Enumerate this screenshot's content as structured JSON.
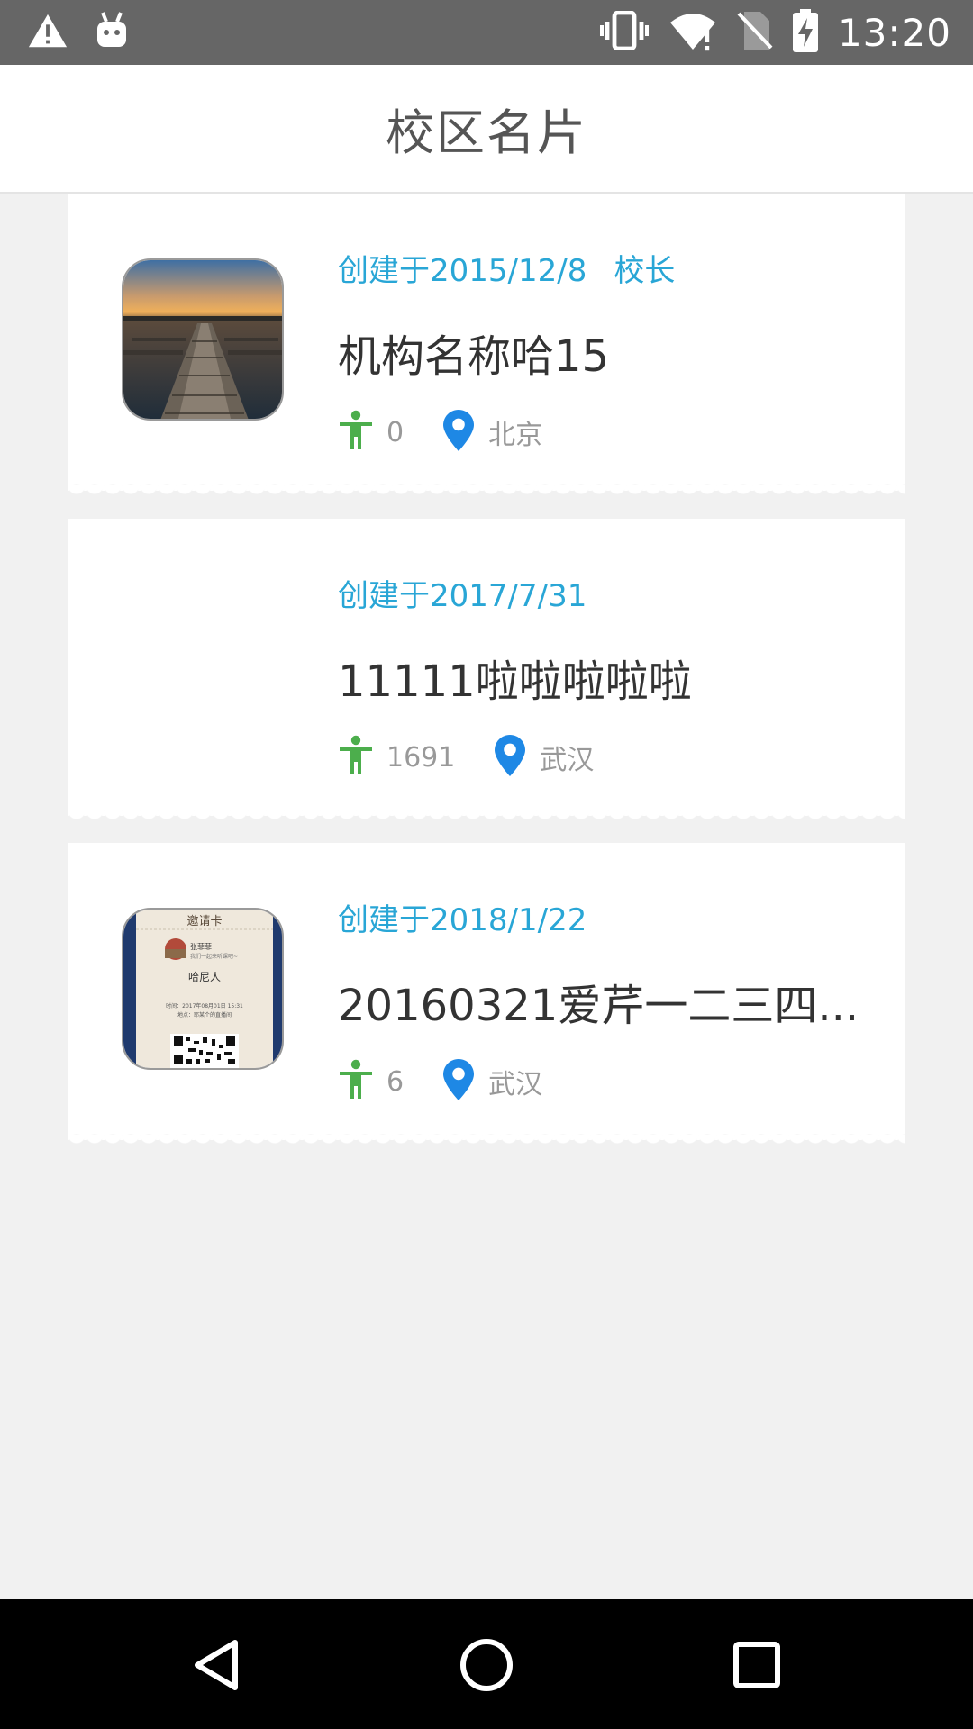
{
  "status_bar": {
    "time": "13:20",
    "icons": [
      "warning-icon",
      "android-icon",
      "vibrate-icon",
      "wifi-icon",
      "no-sim-icon",
      "battery-charging-icon"
    ]
  },
  "app_bar": {
    "title": "校区名片"
  },
  "cards": [
    {
      "created": "创建于2015/12/8",
      "role": "校长",
      "name": "机构名称哈15",
      "members": "0",
      "city": "北京",
      "thumbnail": "pier-photo"
    },
    {
      "created": "创建于2017/7/31",
      "role": "",
      "name": "11111啦啦啦啦啦",
      "members": "1691",
      "city": "武汉",
      "thumbnail": ""
    },
    {
      "created": "创建于2018/1/22",
      "role": "",
      "name": "20160321爱芹一二三四...",
      "members": "6",
      "city": "武汉",
      "thumbnail": "invite-card"
    }
  ],
  "invite_card": {
    "header": "邀请卡",
    "person": "张菲菲",
    "subline": "我们一起来听课吧~",
    "title": "哈尼人",
    "time_line": "时间：2017年08月01日 15:31",
    "place_line": "地点：耶某个的直播间"
  },
  "colors": {
    "accent": "#29a6d6",
    "person_icon": "#4cae4c",
    "location_icon": "#1e88e5",
    "status_bar": "#666666"
  },
  "nav_bar": {
    "icons": [
      "back-icon",
      "home-icon",
      "recents-icon"
    ]
  }
}
